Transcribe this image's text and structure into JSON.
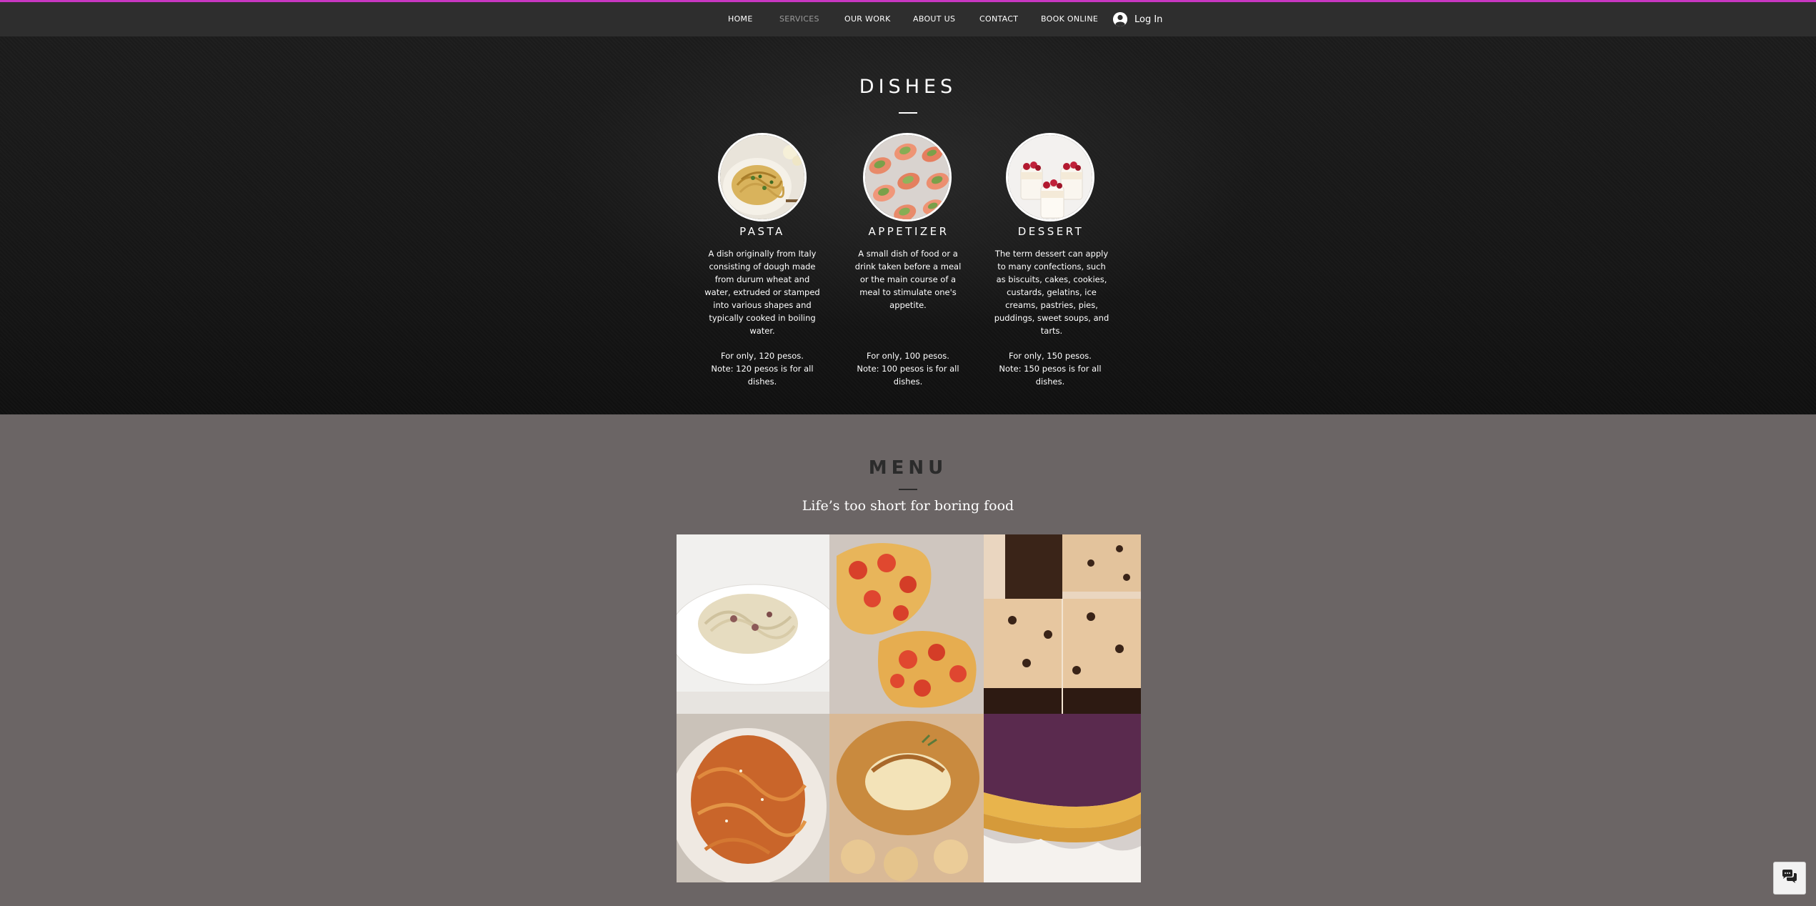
{
  "colors": {
    "accent": "#c837c1",
    "header_bg": "#2e2e2e",
    "dishes_bg": "#161616",
    "menu_bg": "#6b6565"
  },
  "nav": {
    "items": [
      {
        "label": "HOME",
        "active": false
      },
      {
        "label": "SERVICES",
        "active": true
      },
      {
        "label": "OUR WORK",
        "active": false
      },
      {
        "label": "ABOUT US",
        "active": false
      },
      {
        "label": "CONTACT",
        "active": false
      },
      {
        "label": "BOOK ONLINE",
        "active": false
      }
    ],
    "login_label": "Log In",
    "login_icon": "user-avatar-icon"
  },
  "dishes": {
    "title": "DISHES",
    "items": [
      {
        "name": "PASTA",
        "image": "pasta-photo",
        "description": "A dish originally from Italy consisting of dough made from durum wheat and water, extruded or stamped into various shapes and typically cooked in boiling water.",
        "price": "For only, 120 pesos.",
        "note": "Note: 120 pesos is for all dishes."
      },
      {
        "name": "APPETIZER",
        "image": "appetizer-photo",
        "description": "A small dish of food or a drink taken before a meal or the main course of a meal to stimulate one's appetite.",
        "price": "For only, 100 pesos.",
        "note": "Note: 100 pesos is for all dishes."
      },
      {
        "name": "DESSERT",
        "image": "dessert-photo",
        "description": "The term dessert can apply to many confections, such as biscuits, cakes, cookies, custards, gelatins, ice creams, pastries, pies, puddings, sweet soups, and tarts.",
        "price": "For only, 150 pesos.",
        "note": "Note: 150 pesos is for all dishes."
      }
    ]
  },
  "menu": {
    "title": "MENU",
    "tagline": "Life’s too short for boring food",
    "gallery": [
      {
        "image": "carbonara-photo"
      },
      {
        "image": "tomato-bruschetta-photo"
      },
      {
        "image": "cookie-dough-bars-photo"
      },
      {
        "image": "spaghetti-bolognese-photo"
      },
      {
        "image": "baked-brie-pastry-photo"
      },
      {
        "image": "ube-tart-photo"
      }
    ]
  },
  "chat": {
    "icon": "chat-bubbles-icon"
  }
}
